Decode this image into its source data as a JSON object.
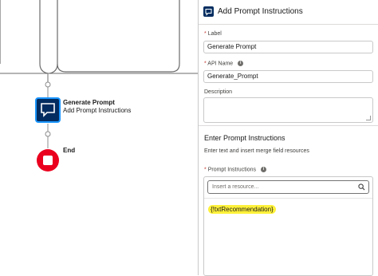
{
  "flow_canvas": {
    "nodes": [
      {
        "title": "Generate Prompt",
        "subtitle": "Add Prompt Instructions",
        "type": "prompt"
      },
      {
        "title": "End",
        "subtitle": "",
        "type": "end"
      }
    ]
  },
  "panel": {
    "title": "Add Prompt Instructions",
    "label_field": {
      "required_mark": "*",
      "label": "Label",
      "value": "Generate Prompt"
    },
    "api_name_field": {
      "required_mark": "*",
      "label": "API Name",
      "value": "Generate_Prompt"
    },
    "description_field": {
      "label": "Description",
      "value": ""
    },
    "prompt_section": {
      "title": "Enter Prompt Instructions",
      "description": "Enter text and insert merge field resources",
      "field_required_mark": "*",
      "field_label": "Prompt Instructions",
      "search_placeholder": "Insert a resource...",
      "content": "{!txtRecommendation}"
    }
  },
  "colors": {
    "prompt_node": "#032d60",
    "end_node": "#ea001e",
    "highlight": "#fff13a"
  }
}
